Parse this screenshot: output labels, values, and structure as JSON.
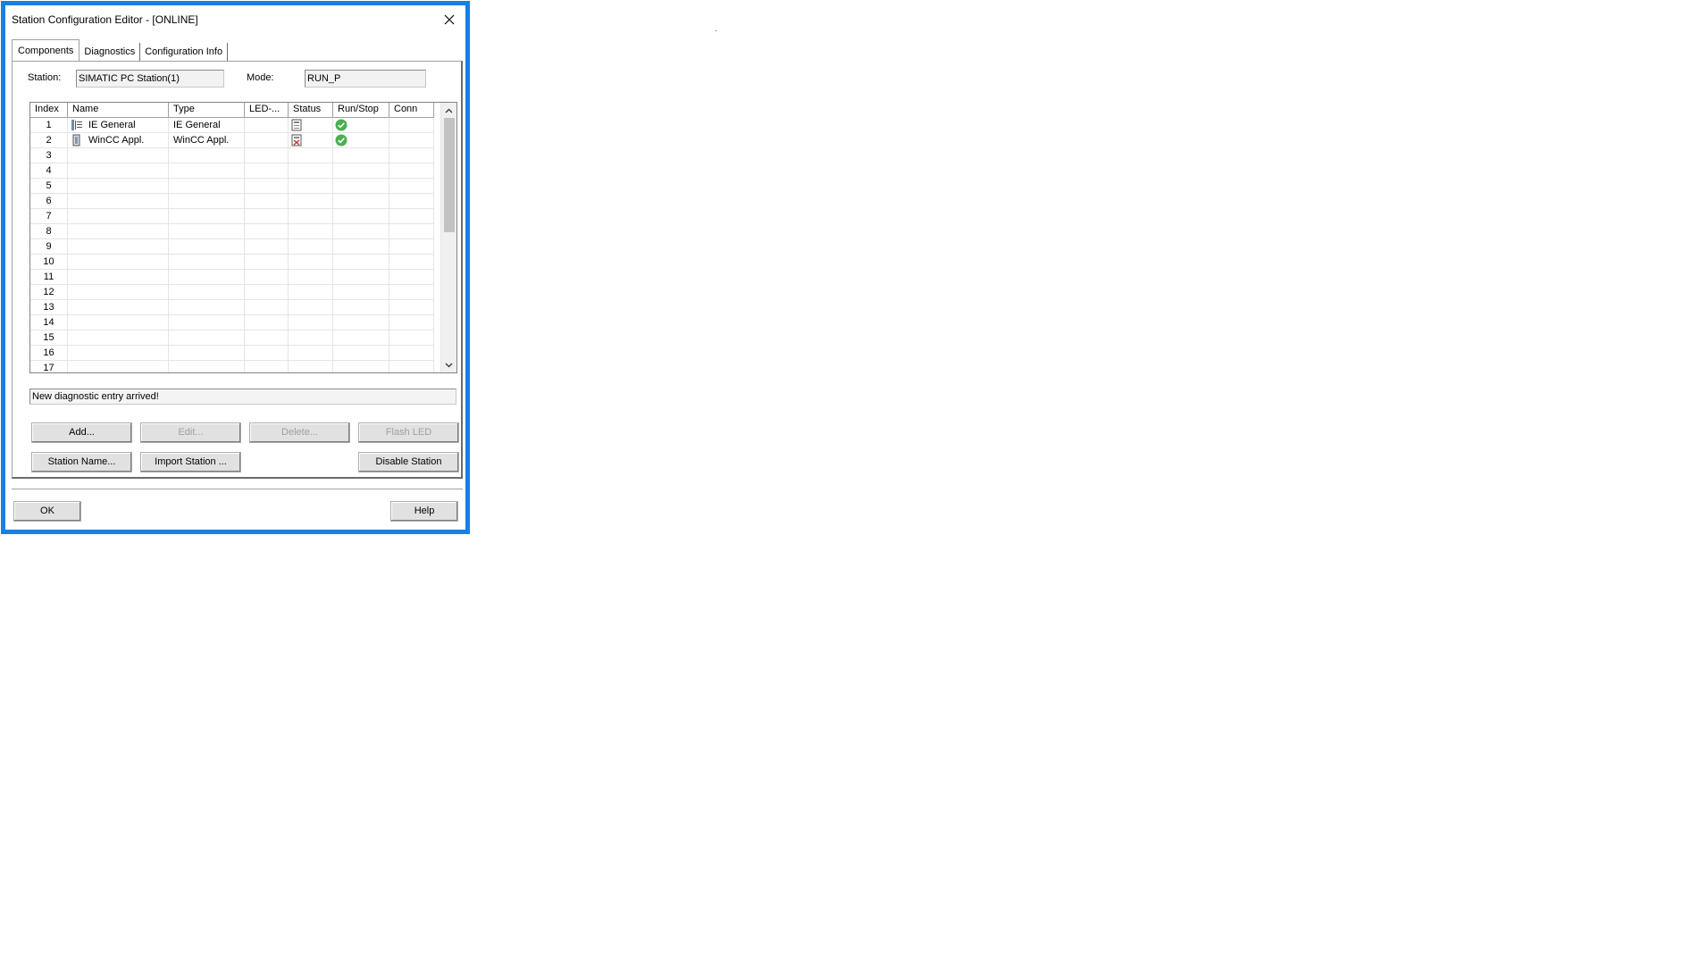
{
  "window": {
    "title": "Station Configuration Editor - [ONLINE]"
  },
  "tabs": [
    {
      "label": "Components",
      "active": true
    },
    {
      "label": "Diagnostics",
      "active": false
    },
    {
      "label": "Configuration Info",
      "active": false
    }
  ],
  "station": {
    "label": "Station:",
    "value": "SIMATIC PC Station(1)"
  },
  "mode": {
    "label": "Mode:",
    "value": "RUN_P"
  },
  "grid": {
    "columns": [
      "Index",
      "Name",
      "Type",
      "LED-...",
      "Status",
      "Run/Stop",
      "Conn"
    ],
    "rows": [
      {
        "index": "1",
        "name": "IE General",
        "type": "IE General",
        "name_icon": "network-card-icon",
        "status_icon": "module-status-icon",
        "runstop_icon": "green-check-icon"
      },
      {
        "index": "2",
        "name": "WinCC Appl.",
        "type": "WinCC Appl.",
        "name_icon": "application-icon",
        "status_icon": "module-error-status-icon",
        "runstop_icon": "green-check-icon"
      },
      {
        "index": "3"
      },
      {
        "index": "4"
      },
      {
        "index": "5"
      },
      {
        "index": "6"
      },
      {
        "index": "7"
      },
      {
        "index": "8"
      },
      {
        "index": "9"
      },
      {
        "index": "10"
      },
      {
        "index": "11"
      },
      {
        "index": "12"
      },
      {
        "index": "13"
      },
      {
        "index": "14"
      },
      {
        "index": "15"
      },
      {
        "index": "16"
      },
      {
        "index": "17"
      }
    ]
  },
  "status_message": "New diagnostic entry arrived!",
  "buttons": {
    "add": "Add...",
    "edit": "Edit...",
    "delete": "Delete...",
    "flash_led": "Flash LED",
    "station_name": "Station Name...",
    "import_station": "Import Station ...",
    "disable_station": "Disable Station",
    "ok": "OK",
    "help": "Help"
  },
  "colors": {
    "window_border": "#1a7fe0",
    "check_green": "#4caf50"
  }
}
